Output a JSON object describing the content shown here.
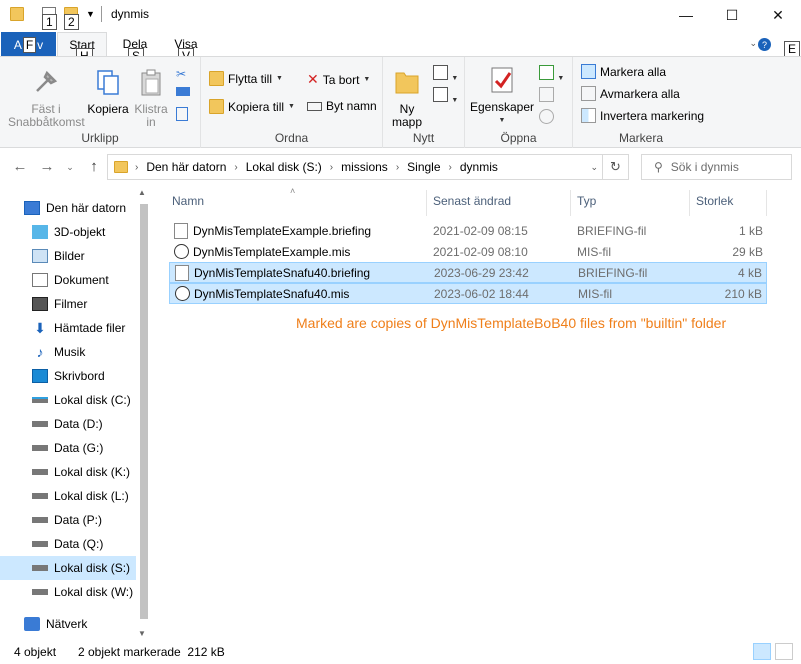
{
  "window": {
    "title": "dynmis",
    "keytips": [
      "1",
      "2"
    ],
    "controls": {
      "minimize": "—",
      "maximize": "☐",
      "close": "✕"
    }
  },
  "ribbon_tabs": {
    "file": "Arkiv",
    "file_keytip": "F",
    "file_keytip_prefix": "A",
    "file_keytip_suffix": "v",
    "start": "Start",
    "start_keytip": "H",
    "share": "Dela",
    "share_keytip": "S",
    "view": "Visa",
    "view_keytip": "V",
    "help_keytip": "E"
  },
  "ribbon": {
    "clipboard": {
      "label": "Urklipp",
      "pin": "Fäst i Snabbåtkomst",
      "copy": "Kopiera",
      "paste": "Klistra in"
    },
    "organize": {
      "label": "Ordna",
      "move_to": "Flytta till",
      "copy_to": "Kopiera till",
      "delete": "Ta bort",
      "rename": "Byt namn"
    },
    "new": {
      "label": "Nytt",
      "new_folder": "Ny mapp"
    },
    "open": {
      "label": "Öppna",
      "properties": "Egenskaper"
    },
    "select": {
      "label": "Markera",
      "select_all": "Markera alla",
      "select_none": "Avmarkera alla",
      "invert": "Invertera markering"
    }
  },
  "address": {
    "crumbs": [
      "Den här datorn",
      "Lokal disk (S:)",
      "missions",
      "Single",
      "dynmis"
    ],
    "search_placeholder": "Sök i dynmis"
  },
  "nav_pane": {
    "items": [
      {
        "label": "Den här datorn",
        "icon": "pc-icon"
      },
      {
        "label": "3D-objekt",
        "icon": "cube-icon"
      },
      {
        "label": "Bilder",
        "icon": "pictures-icon"
      },
      {
        "label": "Dokument",
        "icon": "documents-icon"
      },
      {
        "label": "Filmer",
        "icon": "film-icon"
      },
      {
        "label": "Hämtade filer",
        "icon": "download-icon"
      },
      {
        "label": "Musik",
        "icon": "music-icon"
      },
      {
        "label": "Skrivbord",
        "icon": "desktop-icon"
      },
      {
        "label": "Lokal disk (C:)",
        "icon": "drive-icon"
      },
      {
        "label": "Data (D:)",
        "icon": "drive-icon"
      },
      {
        "label": "Data (G:)",
        "icon": "drive-icon"
      },
      {
        "label": "Lokal disk (K:)",
        "icon": "drive-icon"
      },
      {
        "label": "Lokal disk (L:)",
        "icon": "drive-icon"
      },
      {
        "label": "Data (P:)",
        "icon": "drive-icon"
      },
      {
        "label": "Data (Q:)",
        "icon": "drive-icon"
      },
      {
        "label": "Lokal disk (S:)",
        "icon": "drive-icon"
      },
      {
        "label": "Lokal disk (W:)",
        "icon": "drive-icon"
      },
      {
        "label": "Nätverk",
        "icon": "network-icon"
      }
    ]
  },
  "file_list": {
    "columns": [
      "Namn",
      "Senast ändrad",
      "Typ",
      "Storlek"
    ],
    "files": [
      {
        "name": "DynMisTemplateExample.briefing",
        "modified": "2021-02-09 08:15",
        "type": "BRIEFING-fil",
        "size": "1 kB",
        "selected": false,
        "icon": "text-file-icon"
      },
      {
        "name": "DynMisTemplateExample.mis",
        "modified": "2021-02-09 08:10",
        "type": "MIS-fil",
        "size": "29 kB",
        "selected": false,
        "icon": "mis-file-icon"
      },
      {
        "name": "DynMisTemplateSnafu40.briefing",
        "modified": "2023-06-29 23:42",
        "type": "BRIEFING-fil",
        "size": "4 kB",
        "selected": true,
        "icon": "text-file-icon"
      },
      {
        "name": "DynMisTemplateSnafu40.mis",
        "modified": "2023-06-02 18:44",
        "type": "MIS-fil",
        "size": "210 kB",
        "selected": true,
        "icon": "mis-file-icon"
      }
    ],
    "annotation": "Marked are copies of DynMisTemplateBoB40 files from \"builtin\" folder"
  },
  "status": {
    "count": "4 objekt",
    "selected": "2 objekt markerade  212 kB"
  },
  "colors": {
    "accent": "#1a62ba",
    "selection": "#cce8ff",
    "annotation": "#ef7f1a",
    "folder": "#f2c65c"
  }
}
